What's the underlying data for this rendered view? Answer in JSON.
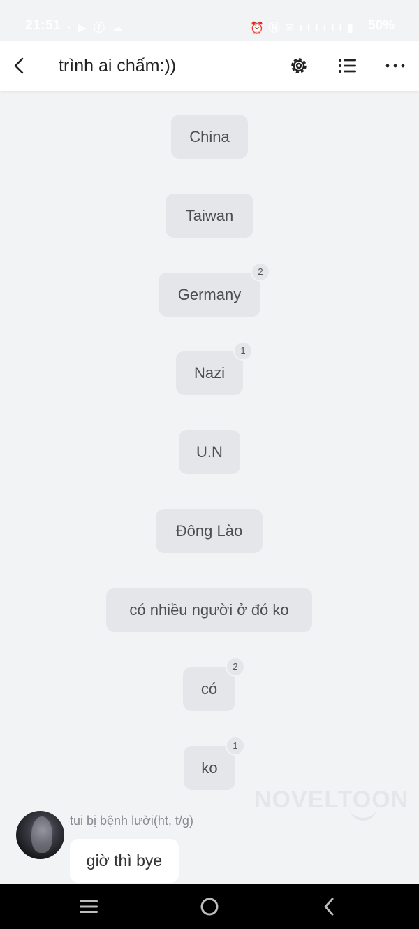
{
  "status_bar": {
    "time": "21:51",
    "battery": "50%"
  },
  "header": {
    "title": "trình ai chấm:))"
  },
  "messages": [
    {
      "text": "China"
    },
    {
      "text": "Taiwan"
    },
    {
      "text": "Germany",
      "badge": "2"
    },
    {
      "text": "Nazi",
      "badge": "1"
    },
    {
      "text": "U.N"
    },
    {
      "text": "Đông Lào"
    },
    {
      "text": "có nhiều người ở đó ko"
    },
    {
      "text": "có",
      "badge": "2"
    },
    {
      "text": "ko",
      "badge": "1"
    }
  ],
  "watermark": "NOVELTOON",
  "chat": {
    "sender": "tui bị bệnh lười(ht, t/g)",
    "message": "giờ thì bye"
  },
  "colors": {
    "background": "#f2f3f5",
    "chip": "#e4e6e9",
    "header": "#ffffff",
    "navbar": "#000000"
  },
  "icons": {
    "back": "chevron-left-icon",
    "settings": "gear-icon",
    "list": "list-icon",
    "more": "more-dots-icon",
    "nav_menu": "menu-icon",
    "nav_home": "home-circle-icon",
    "nav_back": "back-icon"
  }
}
